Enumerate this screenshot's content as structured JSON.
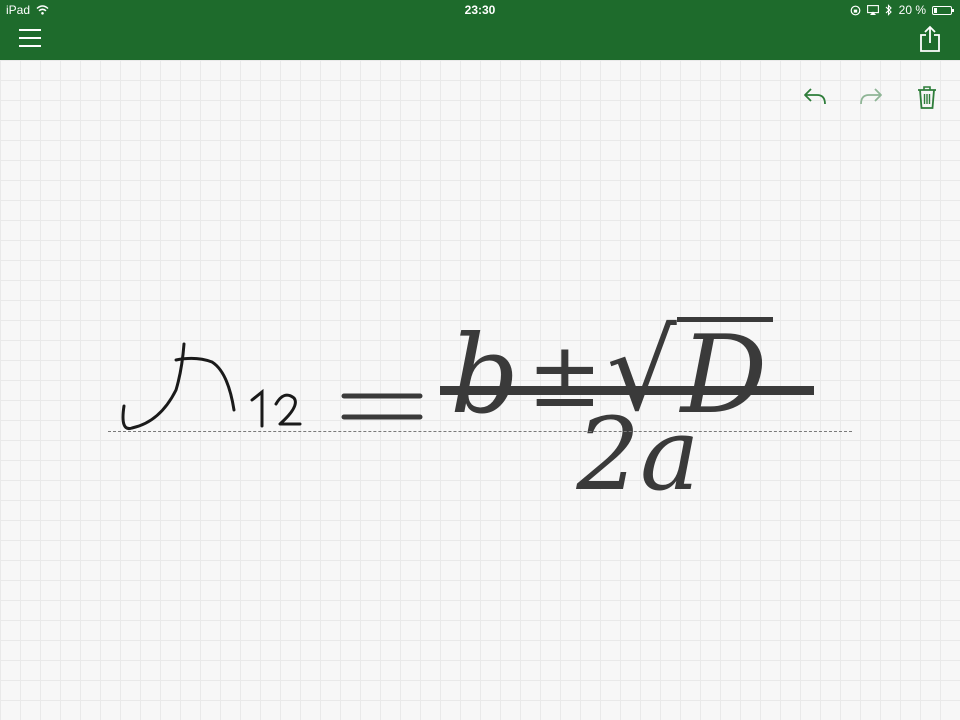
{
  "status": {
    "device": "iPad",
    "time": "23:30",
    "battery": "20 %",
    "battery_level": 0.2
  },
  "icons": {
    "menu": "hamburger-menu-icon",
    "share": "share-icon",
    "undo": "undo-icon",
    "redo": "redo-icon",
    "delete": "trash-icon"
  },
  "colors": {
    "header": "#1e6b2c",
    "toolbar_icon": "#2e7d3a",
    "ink": "#1a1a1a",
    "recognized": "#3a3a3a"
  },
  "equation": {
    "numerator": {
      "term1": "b",
      "operator": "±",
      "radical": "√",
      "radicand": "D"
    },
    "denominator": "2a"
  }
}
